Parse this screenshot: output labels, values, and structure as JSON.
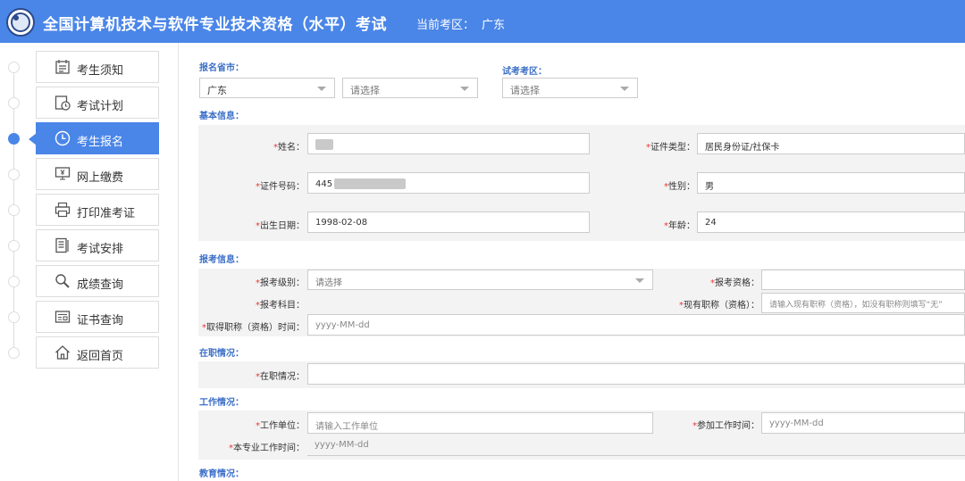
{
  "header": {
    "title": "全国计算机技术与软件专业技术资格（水平）考试",
    "region_label": "当前考区：",
    "region_value": "广东"
  },
  "sidebar": {
    "items": [
      {
        "label": "考生须知",
        "icon": "notice-icon"
      },
      {
        "label": "考试计划",
        "icon": "calendar-clock-icon"
      },
      {
        "label": "考生报名",
        "icon": "clock-icon",
        "active": true
      },
      {
        "label": "网上缴费",
        "icon": "payment-icon"
      },
      {
        "label": "打印准考证",
        "icon": "printer-icon"
      },
      {
        "label": "考试安排",
        "icon": "document-list-icon"
      },
      {
        "label": "成绩查询",
        "icon": "magnifier-icon"
      },
      {
        "label": "证书查询",
        "icon": "certificate-icon"
      },
      {
        "label": "返回首页",
        "icon": "home-icon"
      }
    ]
  },
  "location": {
    "province_label": "报名省市：",
    "province_value": "广东",
    "city_placeholder": "请选择",
    "exam_area_label": "试考考区：",
    "exam_area_placeholder": "请选择"
  },
  "basic": {
    "section": "基本信息：",
    "name_label": "姓名：",
    "idtype_label": "证件类型：",
    "idtype_value": "居民身份证/社保卡",
    "idno_label": "证件号码：",
    "idno_prefix": "445",
    "gender_label": "性别：",
    "gender_value": "男",
    "birth_label": "出生日期：",
    "birth_value": "1998-02-08",
    "age_label": "年龄：",
    "age_value": "24"
  },
  "apply": {
    "section": "报考信息：",
    "level_label": "报考级别：",
    "level_placeholder": "请选择",
    "qual_label": "报考资格：",
    "subject_label": "报考科目：",
    "title_label": "现有职称（资格）：",
    "title_placeholder": "请输入现有职称（资格），如没有职称则填写“无”",
    "title_time_label": "取得职称（资格）时间：",
    "date_placeholder": "yyyy-MM-dd"
  },
  "employment": {
    "section": "在职情况：",
    "label": "在职情况："
  },
  "work": {
    "section": "工作情况：",
    "unit_label": "工作单位：",
    "unit_placeholder": "请输入工作单位",
    "start_label": "参加工作时间：",
    "major_time_label": "本专业工作时间：",
    "date_placeholder": "yyyy-MM-dd"
  },
  "education": {
    "section": "教育情况："
  },
  "colors": {
    "accent": "#4a86e8",
    "required": "#e53935",
    "section_label": "#3c6fc8"
  }
}
